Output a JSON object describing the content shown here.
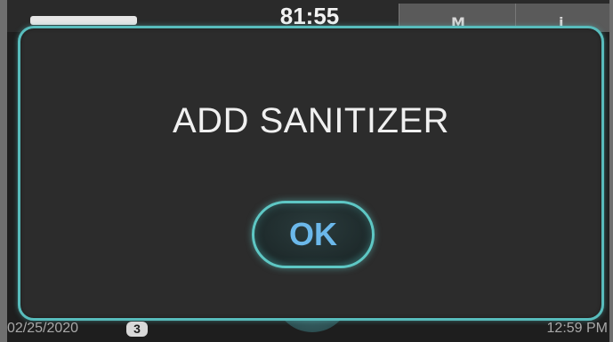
{
  "header": {
    "timer": "81:55",
    "tab_1_glyph": "M",
    "tab_2_glyph": "i"
  },
  "dialog": {
    "message": "ADD SANITIZER",
    "ok_label": "OK"
  },
  "status_bar": {
    "date": "02/25/2020",
    "badge_count": "3",
    "time": "12:59 PM"
  },
  "colors": {
    "accent_border": "#58bcbc",
    "ok_text": "#6bb8ea",
    "dialog_background": "#2c2c2c",
    "screen_background": "#1e1e1e"
  }
}
